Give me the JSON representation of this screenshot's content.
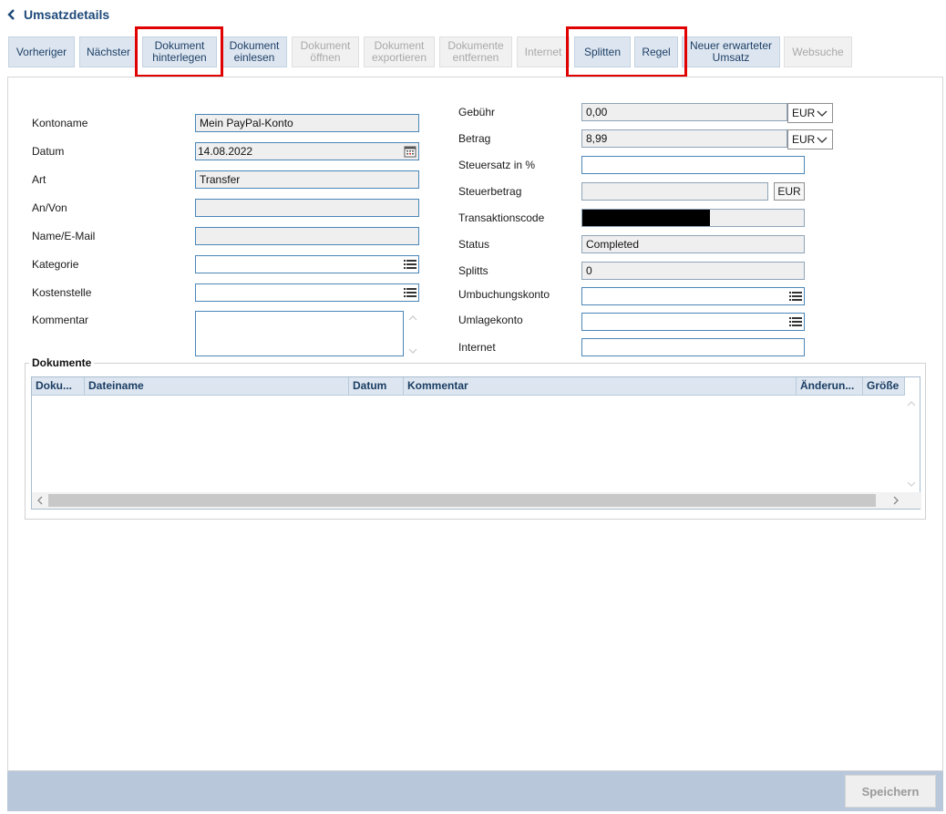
{
  "header": {
    "title": "Umsatzdetails"
  },
  "toolbar": {
    "vorheriger": "Vorheriger",
    "naechster": "Nächster",
    "dokument_hinterlegen": "Dokument\nhinterlegen",
    "dokument_einlesen": "Dokument\neinlesen",
    "dokument_oeffnen": "Dokument\nöffnen",
    "dokument_exportieren": "Dokument\nexportieren",
    "dokumente_entfernen": "Dokumente\nentfernen",
    "internet": "Internet",
    "splitten": "Splitten",
    "regel": "Regel",
    "neuer_umsatz": "Neuer erwarteter\nUmsatz",
    "websuche": "Websuche"
  },
  "form_left": {
    "kontoname": {
      "label": "Kontoname",
      "value": "Mein PayPal-Konto"
    },
    "datum": {
      "label": "Datum",
      "value": "14.08.2022"
    },
    "art": {
      "label": "Art",
      "value": "Transfer"
    },
    "an_von": {
      "label": "An/Von",
      "value": ""
    },
    "name_email": {
      "label": "Name/E-Mail",
      "value": ""
    },
    "kategorie": {
      "label": "Kategorie",
      "value": ""
    },
    "kostenstelle": {
      "label": "Kostenstelle",
      "value": ""
    },
    "kommentar": {
      "label": "Kommentar",
      "value": ""
    }
  },
  "form_right": {
    "gebuehr": {
      "label": "Gebühr",
      "value": "0,00",
      "currency": "EUR"
    },
    "betrag": {
      "label": "Betrag",
      "value": "8,99",
      "currency": "EUR"
    },
    "steuersatz": {
      "label": "Steuersatz in %",
      "value": ""
    },
    "steuerbetrag": {
      "label": "Steuerbetrag",
      "value": "",
      "currency": "EUR"
    },
    "transaktionscode": {
      "label": "Transaktionscode",
      "value": ""
    },
    "status": {
      "label": "Status",
      "value": "Completed"
    },
    "splitts": {
      "label": "Splitts",
      "value": "0"
    },
    "umbuchungskonto": {
      "label": "Umbuchungskonto",
      "value": ""
    },
    "umlagekonto": {
      "label": "Umlagekonto",
      "value": ""
    },
    "internet": {
      "label": "Internet",
      "value": ""
    }
  },
  "documents": {
    "title": "Dokumente",
    "columns": [
      "Doku...",
      "Dateiname",
      "Datum",
      "Kommentar",
      "Änderun...",
      "Größe"
    ]
  },
  "footer": {
    "save_label": "Speichern"
  },
  "colors": {
    "accent": "#1e4a7a",
    "highlight": "#e00000",
    "toolbar_button": "#dde6f0",
    "footer_bar": "#b8c7da"
  }
}
